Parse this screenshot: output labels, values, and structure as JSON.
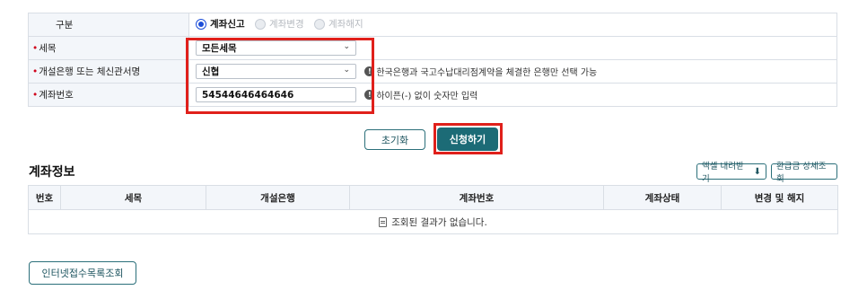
{
  "form": {
    "type_label": "구분",
    "radios": [
      {
        "label": "계좌신고",
        "selected": true
      },
      {
        "label": "계좌변경",
        "selected": false
      },
      {
        "label": "계좌해지",
        "selected": false
      }
    ],
    "required_mark": "•",
    "tax_item_label": "세목",
    "tax_item_value": "모든세목",
    "bank_label": "개설은행 또는 체신관서명",
    "bank_value": "신협",
    "bank_info": "한국은행과 국고수납대리점계약을 체결한 은행만 선택 가능",
    "account_label": "계좌번호",
    "account_value": "54544646464646",
    "account_info": "하이픈(-) 없이 숫자만 입력",
    "info_icon": "!"
  },
  "buttons": {
    "reset": "초기화",
    "apply": "신청하기",
    "excel": "엑셀 내려받기",
    "excel_icon": "⬇",
    "refund": "환급금 상세조회",
    "internet": "인터넷접수목록조회"
  },
  "account_info": {
    "title": "계좌정보",
    "columns": [
      "번호",
      "세목",
      "개설은행",
      "계좌번호",
      "계좌상태",
      "변경 및 해지"
    ],
    "empty_message": "조회된 결과가 없습니다."
  },
  "colors": {
    "highlight": "#e0201b",
    "primary": "#1c6b76",
    "radio_selected": "#1d4ed8"
  }
}
